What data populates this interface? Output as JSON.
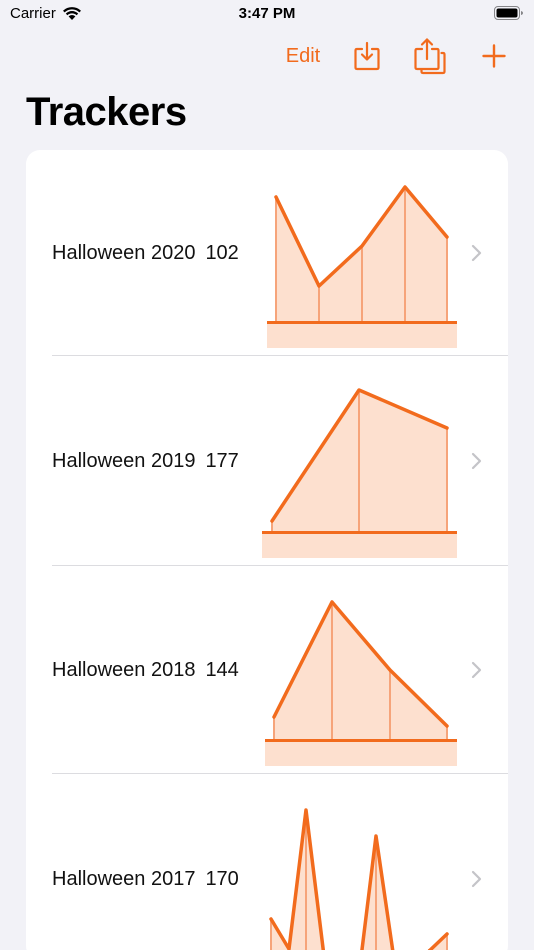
{
  "status_bar": {
    "carrier": "Carrier",
    "time": "3:47 PM"
  },
  "toolbar": {
    "edit_label": "Edit"
  },
  "page": {
    "title": "Trackers"
  },
  "colors": {
    "accent": "#f26b1d",
    "fill": "#fde0cf",
    "chevron": "#c4c4c8"
  },
  "trackers": [
    {
      "name": "Halloween 2020",
      "count": "102"
    },
    {
      "name": "Halloween 2019",
      "count": "177"
    },
    {
      "name": "Halloween 2018",
      "count": "144"
    },
    {
      "name": "Halloween 2017",
      "count": "170"
    }
  ]
}
